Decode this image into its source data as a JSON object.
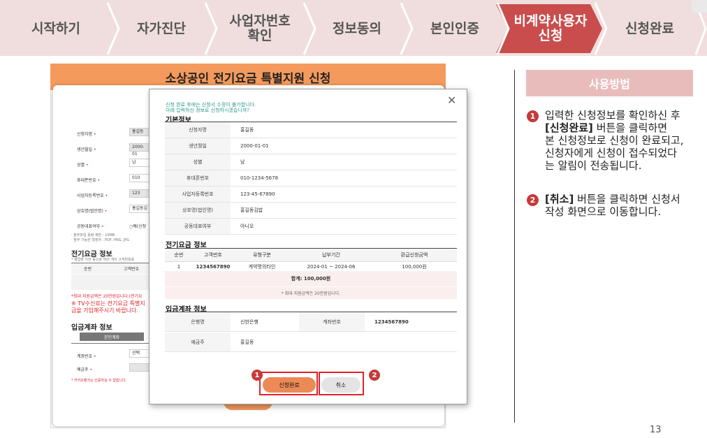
{
  "steps": [
    {
      "line1": "시작하기",
      "line2": "",
      "active": false
    },
    {
      "line1": "자가진단",
      "line2": "",
      "active": false
    },
    {
      "line1": "사업자번호",
      "line2": "확인",
      "active": false
    },
    {
      "line1": "정보동의",
      "line2": "",
      "active": false
    },
    {
      "line1": "본인인증",
      "line2": "",
      "active": false
    },
    {
      "line1": "비계약사용자",
      "line2": "신청",
      "active": true
    },
    {
      "line1": "신청완료",
      "line2": "",
      "active": false
    }
  ],
  "colors": {
    "step_bg": "#f0dede",
    "step_active": "#c94d4d",
    "accent_orange": "#f39a5c",
    "highlight_red": "#e2222a",
    "badge_red": "#c63a3a",
    "howto_pink": "#e9bcbc"
  },
  "form": {
    "title": "소상공인 전기요금 특별지원 신청",
    "fields": [
      {
        "label": "신청자명",
        "value": "홍길동"
      },
      {
        "label": "생년월일",
        "value": "2000-01"
      },
      {
        "label": "성별",
        "value": "남"
      },
      {
        "label": "휴대폰번호",
        "value": "010"
      },
      {
        "label": "사업자등록번호",
        "value": "123"
      },
      {
        "label": "상호명(법인명)",
        "value": "홍길동김"
      },
      {
        "label": "공동대표여부",
        "value": "예(신청"
      }
    ],
    "req_mark": "•",
    "hint1": "· 첨부파일 용량 제한 : 10MB",
    "hint2": "· 첨부 가능한 형장자 : PDF, PNG, JPG",
    "elec_title": "전기요금 정보",
    "elec_sub": "* 영업장 이전 등으로 여러 개의 고객번호를",
    "elec_cols": [
      "순번",
      "고객번호"
    ],
    "red1": "*최대 지원금액은 20만원입니다.(전기요",
    "red2": "※ TV수신료는 전기요금 특별지",
    "red3": "금을 가입해주시기 바랍니다.",
    "acct_title": "입금계좌 정보",
    "auth_btn": "본인계좌",
    "acct_label": "계좌번호",
    "acct_value": "선택",
    "holder_label": "예금주",
    "kakao_note": "* 카카오뱅크는 인증하실 수 없습니다.",
    "bottom_btn": "신청"
  },
  "modal": {
    "notice1": "신청 완료 후에는 신청서 수정이 불가합니다.",
    "notice2": "아래 입력하신 정보로 신청하시겠습니까?",
    "basic_title": "기본정보",
    "basic": [
      {
        "label": "신청자명",
        "value": "홍길동"
      },
      {
        "label": "생년월일",
        "value": "2000-01-01"
      },
      {
        "label": "성별",
        "value": "남"
      },
      {
        "label": "휴대폰번호",
        "value": "010-1234-5678"
      },
      {
        "label": "사업자등록번호",
        "value": "123-45-67890"
      },
      {
        "label": "상호명(법인명)",
        "value": "홍길동김밥"
      },
      {
        "label": "공동대표여부",
        "value": "아니오"
      }
    ],
    "elec_title": "전기요금 정보",
    "elec_headers": [
      "순번",
      "고객번호",
      "유형구분",
      "납부기간",
      "환급신청금액"
    ],
    "elec_row": [
      "1",
      "1234567890",
      "계약명의타인",
      "2024-01 ~ 2024-06",
      "100,000원"
    ],
    "total": "합계: 100,000원",
    "max_note": "* 최대 지원금액은 20만원입니다.",
    "acct_title": "입금계좌 정보",
    "bank_label": "은행명",
    "bank_value": "신한은행",
    "acct_label": "계좌번호",
    "acct_value": "1234567890",
    "holder_label": "예금주",
    "holder_value": "홍길동",
    "btn_done": "신청완료",
    "btn_cancel": "취소",
    "badge1": "1",
    "badge2": "2",
    "close_icon": "close-icon"
  },
  "howto": {
    "title": "사용방법",
    "b1": "1",
    "i1_l1": "입력한 신청정보를 확인하신 후",
    "i1_l2_bold": "[신청완료]",
    "i1_l2_rest": " 버튼을 클릭하면",
    "i1_l3": "본 신청정보로 신청이 완료되고,",
    "i1_l4": "신청자에게 신청이 접수되었다",
    "i1_l5": "는 알림이 전송됩니다.",
    "b2": "2",
    "i2_l1_bold": "[취소]",
    "i2_l1_rest": " 버튼을 클릭하면 신청서",
    "i2_l2": "작성 화면으로 이동합니다."
  },
  "page_number": "13"
}
